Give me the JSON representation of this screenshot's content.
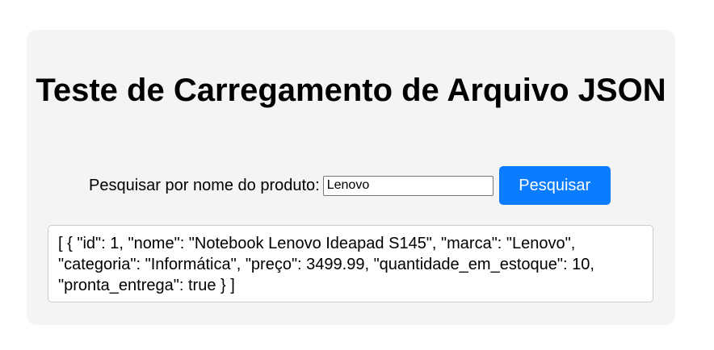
{
  "page": {
    "title": "Teste de Carregamento de Arquivo JSON"
  },
  "search": {
    "label": "Pesquisar por nome do produto:",
    "value": "Lenovo",
    "button_label": "Pesquisar"
  },
  "result": {
    "text": "[ { \"id\": 1, \"nome\": \"Notebook Lenovo Ideapad S145\", \"marca\": \"Lenovo\", \"categoria\": \"Informática\", \"preço\": 3499.99, \"quantidade_em_estoque\": 10, \"pronta_entrega\": true } ]"
  },
  "colors": {
    "card_background": "#f4f4f4",
    "button_background": "#0a7cff",
    "button_text": "#ffffff"
  }
}
